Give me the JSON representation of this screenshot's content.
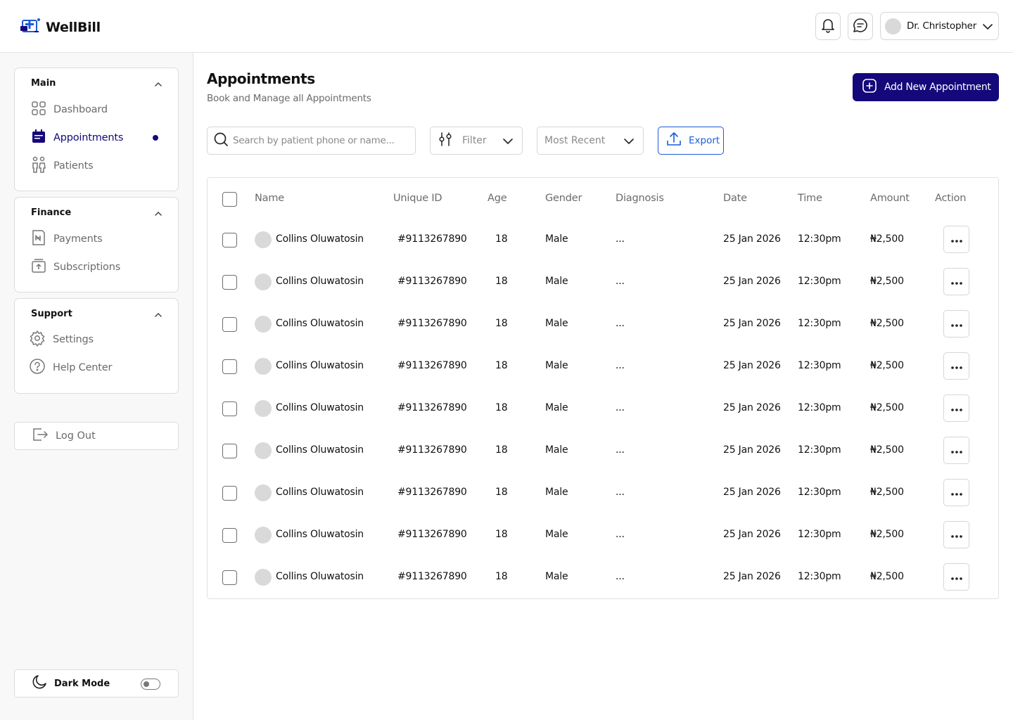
{
  "brand": {
    "name": "WellBill"
  },
  "header": {
    "user_name": "Dr. Christopher"
  },
  "sidebar": {
    "sections": [
      {
        "title": "Main",
        "items": [
          {
            "label": "Dashboard"
          },
          {
            "label": "Appointments",
            "active": true
          },
          {
            "label": "Patients"
          }
        ]
      },
      {
        "title": "Finance",
        "items": [
          {
            "label": "Payments"
          },
          {
            "label": "Subscriptions"
          }
        ]
      },
      {
        "title": "Support",
        "items": [
          {
            "label": "Settings"
          },
          {
            "label": "Help Center"
          }
        ]
      }
    ],
    "logout_label": "Log Out",
    "dark_mode_label": "Dark Mode",
    "dark_mode_on": false
  },
  "page": {
    "title": "Appointments",
    "subtitle": "Book and Manage all Appointments",
    "add_button_label": "Add New Appointment"
  },
  "toolbar": {
    "search_placeholder": "Search by patient phone or name...",
    "filter_label": "Filter",
    "sort_label": "Most Recent",
    "export_label": "Export"
  },
  "table": {
    "columns": [
      "Name",
      "Unique ID",
      "Age",
      "Gender",
      "Diagnosis",
      "Date",
      "Time",
      "Amount",
      "Action"
    ],
    "rows": [
      {
        "name": "Collins Oluwatosin",
        "id": "#9113267890",
        "age": "18",
        "gender": "Male",
        "diagnosis": "...",
        "date": "25 Jan 2026",
        "time": "12:30pm",
        "amount": "₦2,500"
      },
      {
        "name": "Collins Oluwatosin",
        "id": "#9113267890",
        "age": "18",
        "gender": "Male",
        "diagnosis": "...",
        "date": "25 Jan 2026",
        "time": "12:30pm",
        "amount": "₦2,500"
      },
      {
        "name": "Collins Oluwatosin",
        "id": "#9113267890",
        "age": "18",
        "gender": "Male",
        "diagnosis": "...",
        "date": "25 Jan 2026",
        "time": "12:30pm",
        "amount": "₦2,500"
      },
      {
        "name": "Collins Oluwatosin",
        "id": "#9113267890",
        "age": "18",
        "gender": "Male",
        "diagnosis": "...",
        "date": "25 Jan 2026",
        "time": "12:30pm",
        "amount": "₦2,500"
      },
      {
        "name": "Collins Oluwatosin",
        "id": "#9113267890",
        "age": "18",
        "gender": "Male",
        "diagnosis": "...",
        "date": "25 Jan 2026",
        "time": "12:30pm",
        "amount": "₦2,500"
      },
      {
        "name": "Collins Oluwatosin",
        "id": "#9113267890",
        "age": "18",
        "gender": "Male",
        "diagnosis": "...",
        "date": "25 Jan 2026",
        "time": "12:30pm",
        "amount": "₦2,500"
      },
      {
        "name": "Collins Oluwatosin",
        "id": "#9113267890",
        "age": "18",
        "gender": "Male",
        "diagnosis": "...",
        "date": "25 Jan 2026",
        "time": "12:30pm",
        "amount": "₦2,500"
      },
      {
        "name": "Collins Oluwatosin",
        "id": "#9113267890",
        "age": "18",
        "gender": "Male",
        "diagnosis": "...",
        "date": "25 Jan 2026",
        "time": "12:30pm",
        "amount": "₦2,500"
      },
      {
        "name": "Collins Oluwatosin",
        "id": "#9113267890",
        "age": "18",
        "gender": "Male",
        "diagnosis": "...",
        "date": "25 Jan 2026",
        "time": "12:30pm",
        "amount": "₦2,500"
      }
    ]
  },
  "colors": {
    "primary": "#14087a",
    "export_blue": "#1a5dd8",
    "sidebar_bg": "#f8f8f8"
  },
  "icons": [
    "logo-icon",
    "bell-icon",
    "chat-icon",
    "chevron-down-icon",
    "chevron-up-icon",
    "grid-icon",
    "calendar-icon",
    "patients-icon",
    "naira-receipt-icon",
    "subscription-icon",
    "gear-icon",
    "help-icon",
    "logout-icon",
    "moon-icon",
    "plus-square-icon",
    "search-icon",
    "filter-sliders-icon",
    "upload-icon",
    "more-dots-icon"
  ]
}
